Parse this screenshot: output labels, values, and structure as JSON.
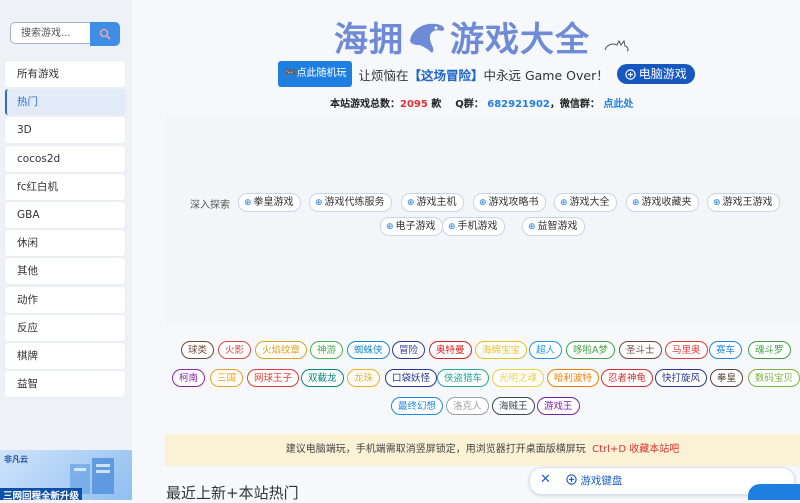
{
  "search": {
    "placeholder": "搜索游戏..."
  },
  "sidebar": {
    "items": [
      {
        "label": "所有游戏"
      },
      {
        "label": "热门"
      },
      {
        "label": "3D"
      },
      {
        "label": "cocos2d"
      },
      {
        "label": "fc红白机"
      },
      {
        "label": "GBA"
      },
      {
        "label": "休闲"
      },
      {
        "label": "其他"
      },
      {
        "label": "动作"
      },
      {
        "label": "反应"
      },
      {
        "label": "棋牌"
      },
      {
        "label": "益智"
      }
    ],
    "ad": {
      "logo": "非凡云",
      "text": "三网回程全新升级"
    }
  },
  "header": {
    "title_left": "海拥",
    "title_right": "游戏大全",
    "random_button": "点此随机玩",
    "promo_prefix": "让烦恼在",
    "promo_highlight": "【这场冒险】",
    "promo_suffix": "中永远 Game Over！",
    "pc_button": "电脑游戏"
  },
  "stats": {
    "total_label": "本站游戏总数：",
    "total_count": "2095",
    "total_unit": "款",
    "qq_label": "Q群：",
    "qq_number": "682921902",
    "wechat_label": "，微信群：",
    "wechat_link": "点此处"
  },
  "explore": {
    "label": "深入探索",
    "links": [
      "拳皇游戏",
      "游戏代练服务",
      "游戏主机",
      "游戏攻略书",
      "游戏大全",
      "游戏收藏夹",
      "游戏王游戏",
      "电子游戏",
      "手机游戏",
      "益智游戏"
    ]
  },
  "tags": [
    {
      "label": "球类",
      "color": "#6b4a3a"
    },
    {
      "label": "火影",
      "color": "#e04a4a"
    },
    {
      "label": "火焰纹章",
      "color": "#e0a020"
    },
    {
      "label": "神游",
      "color": "#4caf50"
    },
    {
      "label": "蜘蛛侠",
      "color": "#1e88c8"
    },
    {
      "label": "冒险",
      "color": "#2f3a8f"
    },
    {
      "label": "奥特曼",
      "color": "#d82020"
    },
    {
      "label": "海绵宝宝",
      "color": "#e8c020"
    },
    {
      "label": "超人",
      "color": "#2196f3"
    },
    {
      "label": "哆啦A梦",
      "color": "#43a047"
    },
    {
      "label": "圣斗士",
      "color": "#6d4c41"
    },
    {
      "label": "马里奥",
      "color": "#e53935"
    },
    {
      "label": "赛车",
      "color": "#1e88e5"
    },
    {
      "label": "魂斗罗",
      "color": "#43a047"
    },
    {
      "label": "柯南",
      "color": "#8e24aa"
    },
    {
      "label": "三国",
      "color": "#f0a020"
    },
    {
      "label": "网球王子",
      "color": "#e53935"
    },
    {
      "label": "双截龙",
      "color": "#00897b"
    },
    {
      "label": "龙珠",
      "color": "#f0b020"
    },
    {
      "label": "口袋妖怪",
      "color": "#283593"
    },
    {
      "label": "侠盗猎车",
      "color": "#26a69a"
    },
    {
      "label": "光明之魂",
      "color": "#f0d040"
    },
    {
      "label": "哈利波特",
      "color": "#f57c00"
    },
    {
      "label": "忍者神龟",
      "color": "#d32f2f"
    },
    {
      "label": "快打旋风",
      "color": "#283593"
    },
    {
      "label": "拳皇",
      "color": "#5d4037"
    },
    {
      "label": "数码宝贝",
      "color": "#7cb342"
    },
    {
      "label": "最终幻想",
      "color": "#1e88e5"
    },
    {
      "label": "洛克人",
      "color": "#9e9e9e"
    },
    {
      "label": "海贼王",
      "color": "#37474f"
    },
    {
      "label": "游戏王",
      "color": "#7b1fa2"
    }
  ],
  "notice": {
    "text": "建议电脑端玩，手机端需取消竖屏锁定，用浏览器打开桌面版横屏玩",
    "shortcut": "Ctrl+D 收藏本站吧"
  },
  "bottom": {
    "section_title": "最近上新+本站热门"
  },
  "keyboard": {
    "label": "游戏键盘"
  }
}
